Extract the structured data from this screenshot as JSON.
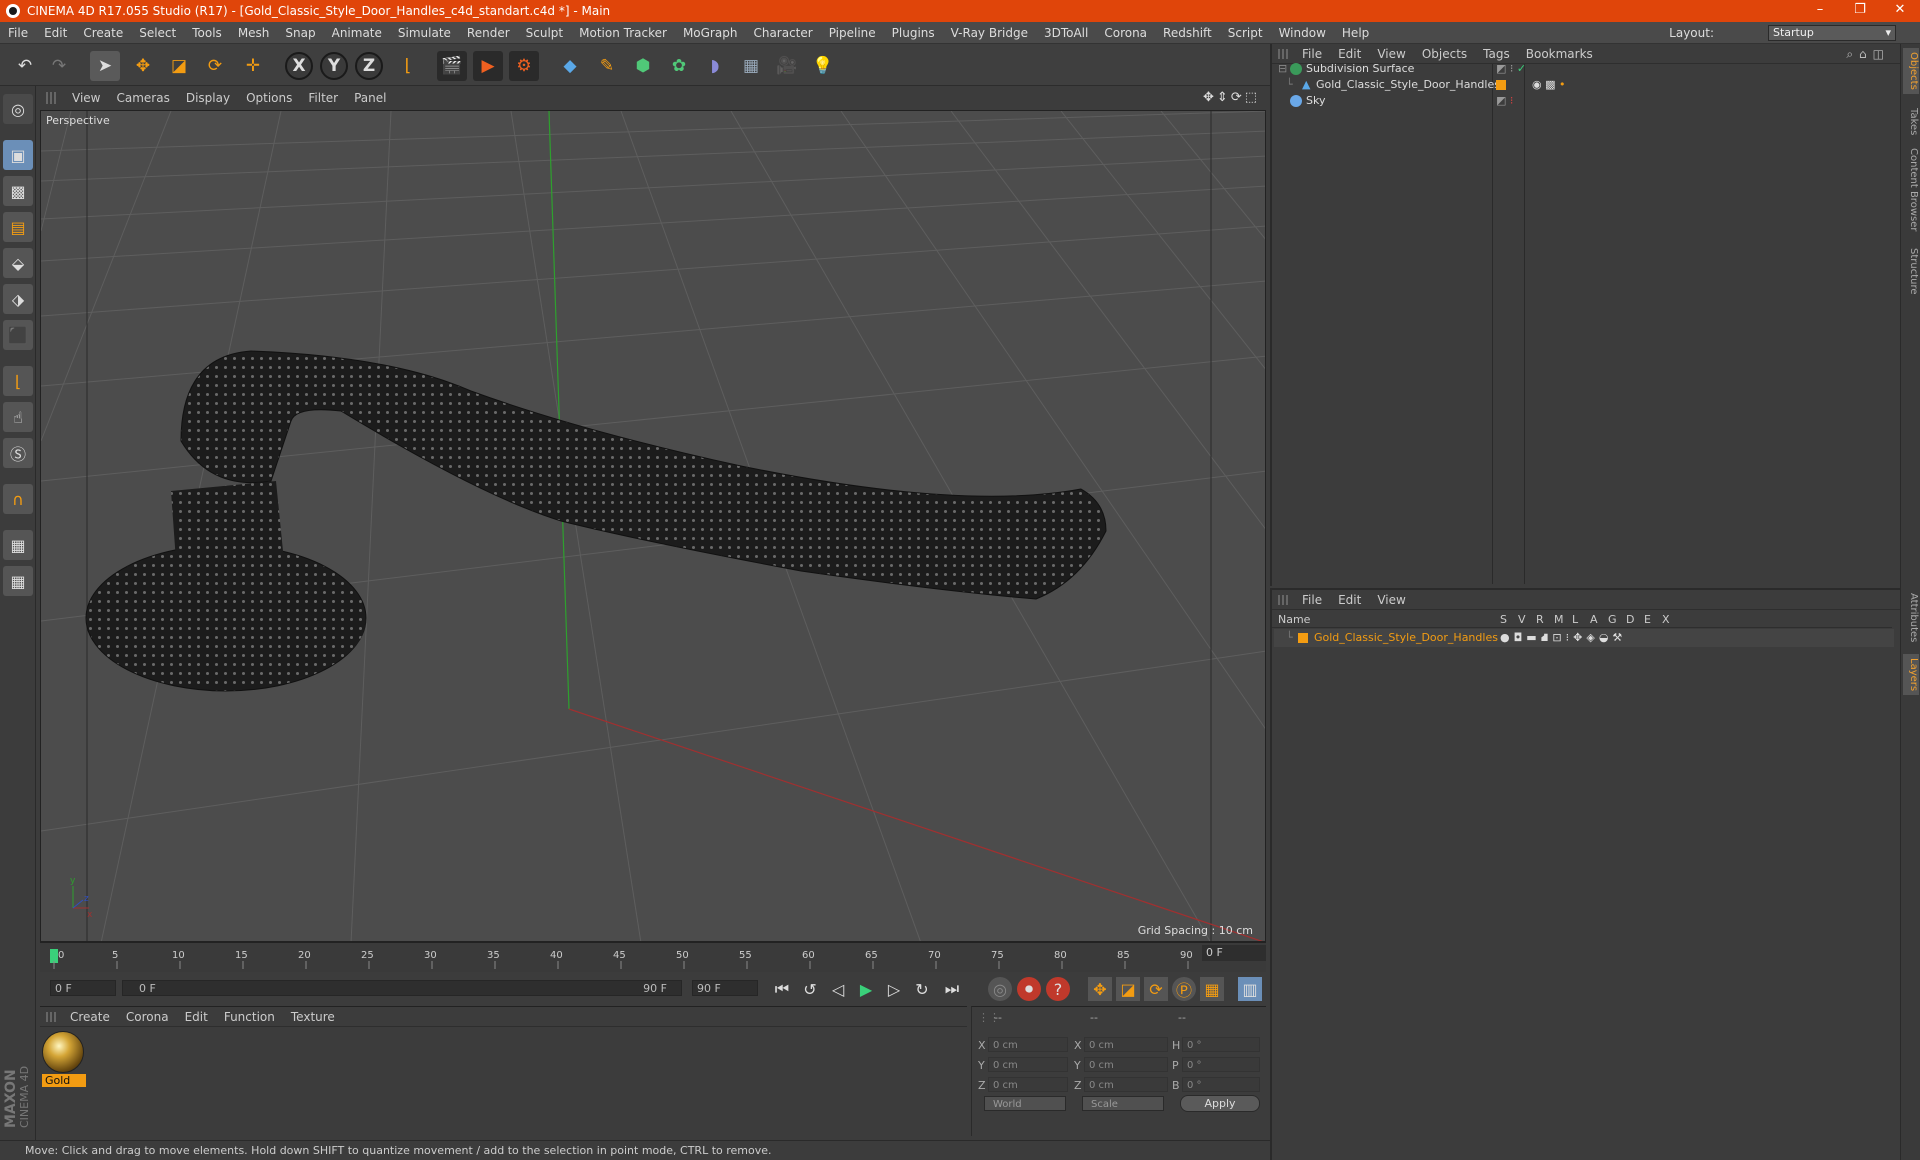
{
  "window": {
    "title": "CINEMA 4D R17.055 Studio (R17) - [Gold_Classic_Style_Door_Handles_c4d_standart.c4d *] - Main",
    "minimize": "–",
    "restore": "❐",
    "close": "✕"
  },
  "menubar": [
    "File",
    "Edit",
    "Create",
    "Select",
    "Tools",
    "Mesh",
    "Snap",
    "Animate",
    "Simulate",
    "Render",
    "Sculpt",
    "Motion Tracker",
    "MoGraph",
    "Character",
    "Pipeline",
    "Plugins",
    "V-Ray Bridge",
    "3DToAll",
    "Corona",
    "Redshift",
    "Script",
    "Window",
    "Help"
  ],
  "layout": {
    "label": "Layout:",
    "value": "Startup"
  },
  "toolbar": {
    "x": "X",
    "y": "Y",
    "z": "Z",
    "icons": [
      "undo-icon",
      "redo-icon",
      "select-icon",
      "move-icon",
      "scale-icon",
      "rotate-icon",
      "move-last-icon",
      "x-axis",
      "y-axis",
      "z-axis",
      "coord-system-icon",
      "render-region-icon",
      "render-view-icon",
      "render-settings-icon",
      "cube-icon",
      "pen-icon",
      "subdivision-icon",
      "array-icon",
      "deformer-icon",
      "floor-icon",
      "camera-icon",
      "light-icon"
    ]
  },
  "viewport": {
    "menu": [
      "View",
      "Cameras",
      "Display",
      "Options",
      "Filter",
      "Panel"
    ],
    "label": "Perspective",
    "grid_spacing": "Grid Spacing : 10 cm",
    "nav": "✥⇕⟳⬚"
  },
  "timeline": {
    "ticks": [
      "0",
      "5",
      "10",
      "15",
      "20",
      "25",
      "30",
      "35",
      "40",
      "45",
      "50",
      "55",
      "60",
      "65",
      "70",
      "75",
      "80",
      "85",
      "90"
    ],
    "current_frame": "0 F"
  },
  "transport": {
    "start": "0 F",
    "range_start": "0 F",
    "range_end": "90 F",
    "end": "90 F"
  },
  "material_panel": {
    "menu": [
      "Create",
      "Corona",
      "Edit",
      "Function",
      "Texture"
    ],
    "materials": [
      {
        "name": "Gold"
      }
    ]
  },
  "coords": {
    "headers": [
      "--",
      "--",
      "--"
    ],
    "rows": [
      {
        "k1": "X",
        "v1": "0 cm",
        "k2": "X",
        "v2": "0 cm",
        "k3": "H",
        "v3": "0 °"
      },
      {
        "k1": "Y",
        "v1": "0 cm",
        "k2": "Y",
        "v2": "0 cm",
        "k3": "P",
        "v3": "0 °"
      },
      {
        "k1": "Z",
        "v1": "0 cm",
        "k2": "Z",
        "v2": "0 cm",
        "k3": "B",
        "v3": "0 °"
      }
    ],
    "world": "World",
    "scale": "Scale",
    "apply": "Apply"
  },
  "status": "Move: Click and drag to move elements. Hold down SHIFT to quantize movement / add to the selection in point mode, CTRL to remove.",
  "object_manager": {
    "menu": [
      "File",
      "Edit",
      "View",
      "Objects",
      "Tags",
      "Bookmarks"
    ],
    "objects": [
      {
        "name": "Subdivision Surface"
      },
      {
        "name": "Gold_Classic_Style_Door_Handles"
      },
      {
        "name": "Sky"
      }
    ]
  },
  "layer_manager": {
    "menu": [
      "File",
      "Edit",
      "View"
    ],
    "header_name": "Name",
    "columns": [
      "S",
      "V",
      "R",
      "M",
      "L",
      "A",
      "G",
      "D",
      "E",
      "X"
    ],
    "layers": [
      {
        "name": "Gold_Classic_Style_Door_Handles",
        "color": "#f39c12"
      }
    ]
  },
  "right_tabs": [
    "Objects",
    "Takes",
    "Content Browser",
    "Structure",
    "Attributes",
    "Layers"
  ],
  "brand": {
    "maxon": "MAXON",
    "cinema": "CINEMA 4D"
  },
  "colors": {
    "title_bar": "#e0450a",
    "accent": "#f39c12",
    "selected_tool": "#6b8fb8"
  }
}
